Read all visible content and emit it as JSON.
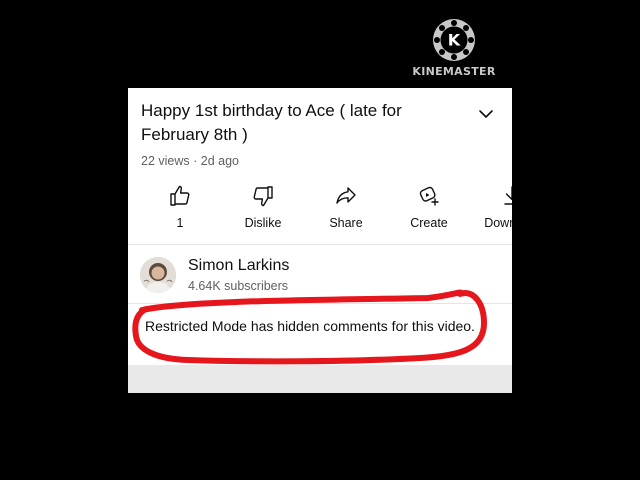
{
  "watermark": {
    "logo_letter": "K",
    "text": "KINEMASTER"
  },
  "video": {
    "title": "Happy 1st birthday to Ace ( late for February 8th )",
    "meta": "22 views · 2d ago"
  },
  "actions": [
    {
      "label": "1",
      "icon": "thumbs-up-icon"
    },
    {
      "label": "Dislike",
      "icon": "thumbs-down-icon"
    },
    {
      "label": "Share",
      "icon": "share-icon"
    },
    {
      "label": "Create",
      "icon": "create-icon"
    },
    {
      "label": "Download",
      "icon": "download-icon"
    }
  ],
  "channel": {
    "name": "Simon Larkins",
    "subscribers": "4.64K subscribers"
  },
  "comments": {
    "restricted_message": "Restricted Mode has hidden comments for this video."
  },
  "colors": {
    "annotation_red": "#e5171c",
    "text_primary": "#0f0f0f",
    "text_secondary": "#606060"
  }
}
